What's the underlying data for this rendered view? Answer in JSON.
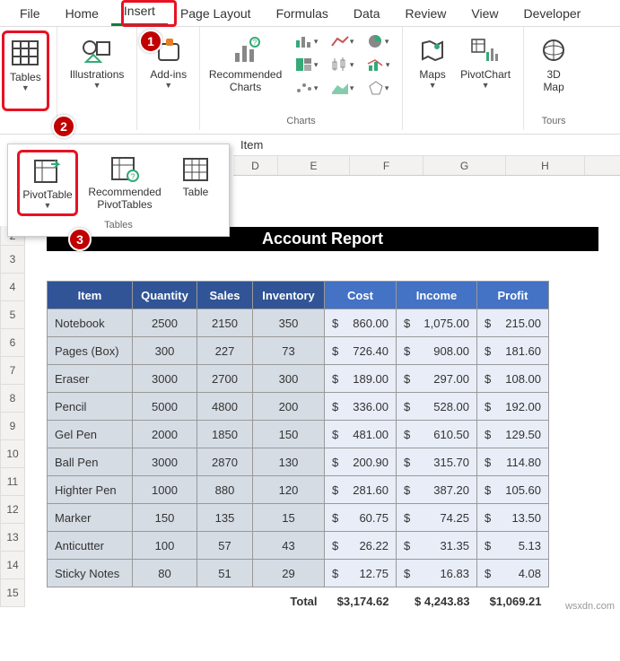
{
  "ribbon": {
    "tabs": [
      "File",
      "Home",
      "Insert",
      "Page Layout",
      "Formulas",
      "Data",
      "Review",
      "View",
      "Developer"
    ],
    "active_tab": "Insert",
    "groups": {
      "tables_btn": "Tables",
      "illustrations_btn": "Illustrations",
      "addins_btn": "Add-ins",
      "reco_charts_btn": "Recommended Charts",
      "charts_label": "Charts",
      "maps_btn": "Maps",
      "pivotchart_btn": "PivotChart",
      "threed_btn": "3D Map",
      "tours_label": "Tours"
    }
  },
  "tables_dropdown": {
    "pivottable": "PivotTable",
    "reco_pivot": "Recommended PivotTables",
    "table": "Table",
    "group": "Tables"
  },
  "markers": {
    "m1": "1",
    "m2": "2",
    "m3": "3"
  },
  "formula_bar": {
    "value": "Item"
  },
  "columns": [
    "D",
    "E",
    "F",
    "G",
    "H"
  ],
  "row_nums": [
    "2",
    "3",
    "4",
    "5",
    "6",
    "7",
    "8",
    "9",
    "10",
    "11",
    "12",
    "13",
    "14",
    "15"
  ],
  "report": {
    "title": "Account Report",
    "headers": {
      "item": "Item",
      "qty": "Quantity",
      "sales": "Sales",
      "inv": "Inventory",
      "cost": "Cost",
      "income": "Income",
      "profit": "Profit"
    },
    "rows": [
      {
        "item": "Notebook",
        "qty": "2500",
        "sales": "2150",
        "inv": "350",
        "cost": "860.00",
        "income": "1,075.00",
        "profit": "215.00"
      },
      {
        "item": "Pages (Box)",
        "qty": "300",
        "sales": "227",
        "inv": "73",
        "cost": "726.40",
        "income": "908.00",
        "profit": "181.60"
      },
      {
        "item": "Eraser",
        "qty": "3000",
        "sales": "2700",
        "inv": "300",
        "cost": "189.00",
        "income": "297.00",
        "profit": "108.00"
      },
      {
        "item": "Pencil",
        "qty": "5000",
        "sales": "4800",
        "inv": "200",
        "cost": "336.00",
        "income": "528.00",
        "profit": "192.00"
      },
      {
        "item": "Gel Pen",
        "qty": "2000",
        "sales": "1850",
        "inv": "150",
        "cost": "481.00",
        "income": "610.50",
        "profit": "129.50"
      },
      {
        "item": "Ball Pen",
        "qty": "3000",
        "sales": "2870",
        "inv": "130",
        "cost": "200.90",
        "income": "315.70",
        "profit": "114.80"
      },
      {
        "item": "Highter Pen",
        "qty": "1000",
        "sales": "880",
        "inv": "120",
        "cost": "281.60",
        "income": "387.20",
        "profit": "105.60"
      },
      {
        "item": "Marker",
        "qty": "150",
        "sales": "135",
        "inv": "15",
        "cost": "60.75",
        "income": "74.25",
        "profit": "13.50"
      },
      {
        "item": "Anticutter",
        "qty": "100",
        "sales": "57",
        "inv": "43",
        "cost": "26.22",
        "income": "31.35",
        "profit": "5.13"
      },
      {
        "item": "Sticky Notes",
        "qty": "80",
        "sales": "51",
        "inv": "29",
        "cost": "12.75",
        "income": "16.83",
        "profit": "4.08"
      }
    ],
    "totals": {
      "label": "Total",
      "cost": "$3,174.62",
      "income": "$ 4,243.83",
      "profit": "$1,069.21"
    },
    "currency": "$"
  },
  "watermark": "wsxdn.com"
}
